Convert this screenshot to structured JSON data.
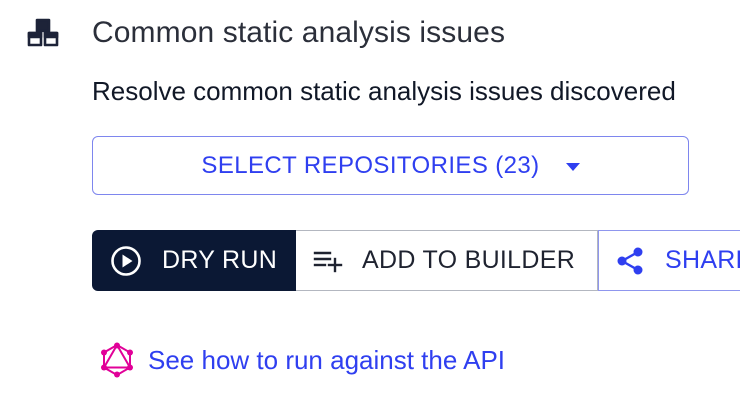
{
  "recipe": {
    "title": "Common static analysis issues",
    "description": "Resolve common static analysis issues discovered"
  },
  "repositories": {
    "select_label": "SELECT REPOSITORIES (23)"
  },
  "actions": {
    "dry_run_label": "DRY RUN",
    "add_to_builder_label": "ADD TO BUILDER",
    "share_label": "SHARE"
  },
  "api_link": {
    "label": "See how to run against the API"
  },
  "icons": {
    "recipe": "cubes-icon",
    "dry_run": "play-circle-icon",
    "add_to_builder": "playlist-add-icon",
    "share": "share-icon",
    "api": "graphql-icon"
  },
  "colors": {
    "accent": "#2f3ff0",
    "dark_button": "#0b1834",
    "graphql_pink": "#e10098"
  }
}
